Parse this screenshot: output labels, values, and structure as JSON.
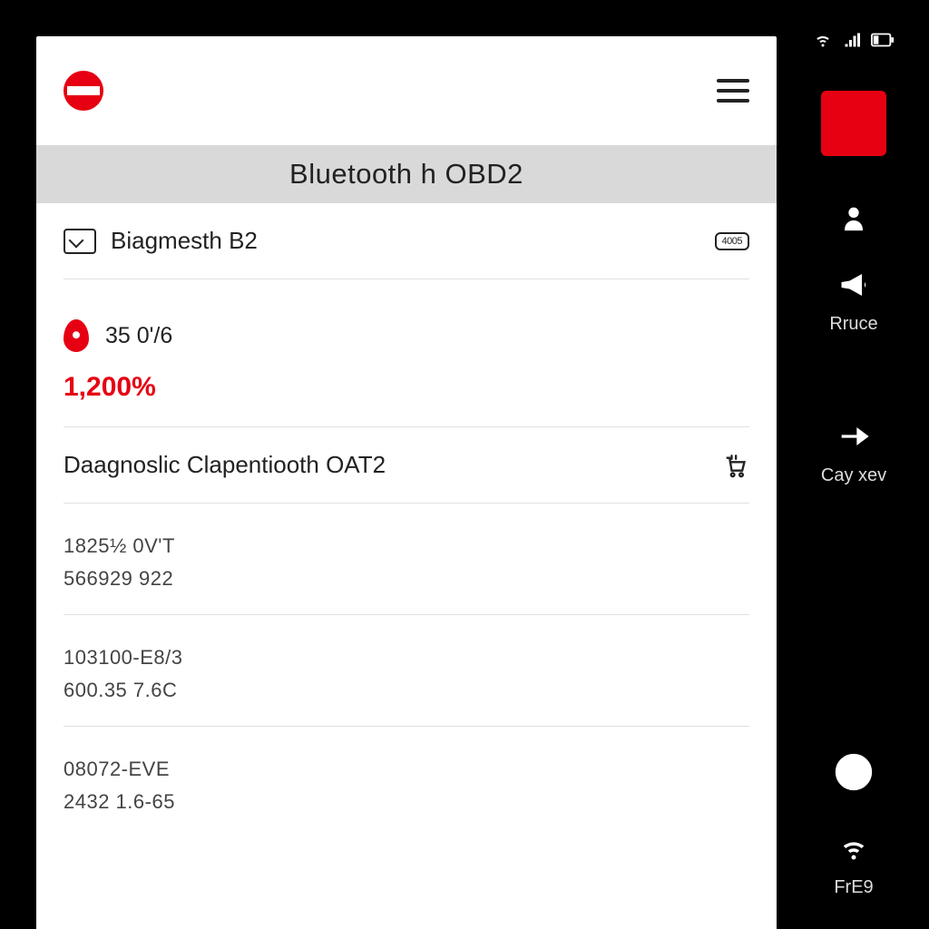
{
  "header": {
    "title": "Bluetooth h OBD2"
  },
  "rows": {
    "r1": {
      "label": "Biagmesth B2",
      "badge": "4005"
    },
    "r2": {
      "value_a": "35 0'/6",
      "value_b": "1,200%"
    },
    "r3": {
      "label": "Daagnoslic Clapentiooth OAT2"
    },
    "codes": {
      "c1a": "1825½ 0V'T",
      "c1b": "566929 922",
      "c2a": "103100-E8/3",
      "c2b": "600.35 7.6C",
      "c3a": "08072-EVE",
      "c3b": "2432 1.6-65"
    }
  },
  "sidebar": {
    "item1": "Rruce",
    "item2": "Cay xev",
    "item3": "FrE9"
  }
}
